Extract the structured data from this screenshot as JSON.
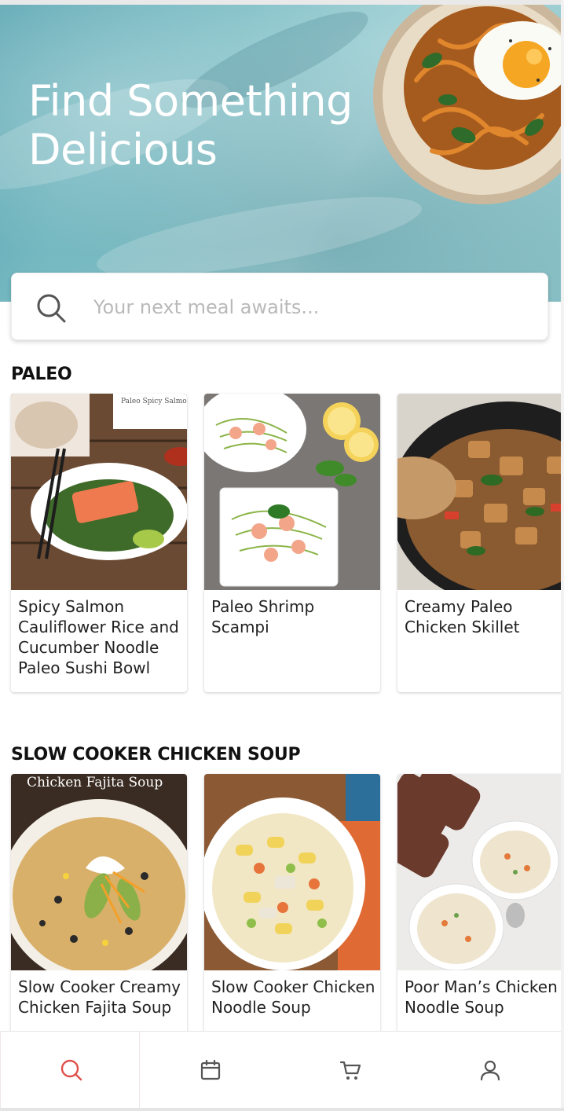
{
  "hero": {
    "title": "Find Something Delicious"
  },
  "search": {
    "placeholder": "Your next meal awaits..."
  },
  "sections": [
    {
      "title": "PALEO",
      "cards": [
        {
          "title": "Spicy Salmon Cauliflower Rice and Cucumber Noodle Paleo Sushi Bowl",
          "image_caption": "Paleo Spicy Salmon Sushi Bowl"
        },
        {
          "title": "Paleo Shrimp Scampi"
        },
        {
          "title": "Creamy Paleo Chicken Skillet"
        }
      ]
    },
    {
      "title": "SLOW COOKER CHICKEN SOUP",
      "cards": [
        {
          "title": "Slow Cooker Creamy Chicken Fajita Soup",
          "image_caption": "Chicken Fajita Soup"
        },
        {
          "title": "Slow Cooker Chicken Noodle Soup"
        },
        {
          "title": "Poor Man’s Chicken Noodle Soup"
        }
      ]
    }
  ],
  "nav": {
    "items": [
      {
        "icon": "search-icon",
        "active": true
      },
      {
        "icon": "calendar-icon",
        "active": false
      },
      {
        "icon": "cart-icon",
        "active": false
      },
      {
        "icon": "user-icon",
        "active": false
      }
    ],
    "active_color": "#e0504a",
    "inactive_color": "#555555"
  }
}
